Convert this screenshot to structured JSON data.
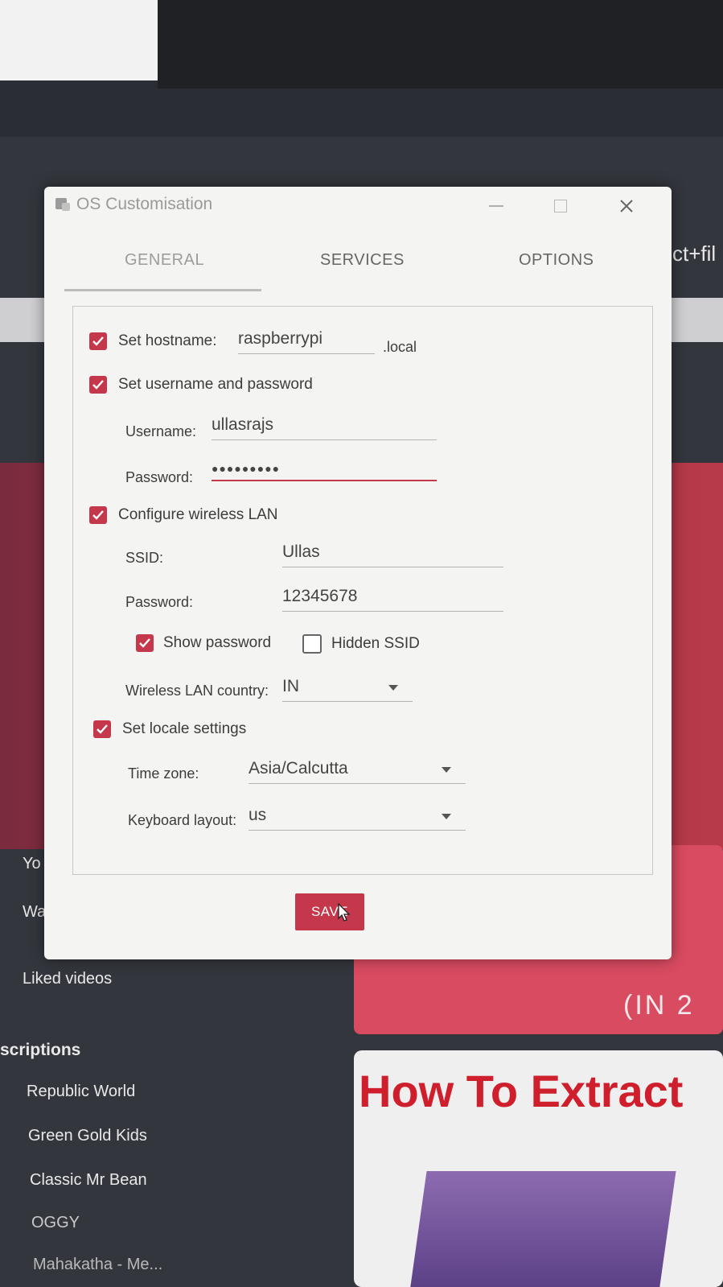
{
  "dialog": {
    "title": "OS Customisation",
    "tabs": [
      "GENERAL",
      "SERVICES",
      "OPTIONS"
    ],
    "active_tab": "GENERAL",
    "hostname": {
      "label": "Set hostname:",
      "checked": true,
      "value": "raspberrypi",
      "suffix": ".local"
    },
    "user": {
      "label": "Set username and password",
      "checked": true,
      "username_label": "Username:",
      "username": "ullasrajs",
      "password_label": "Password:",
      "password_mask": "●●●●●●●●●"
    },
    "wifi": {
      "label": "Configure wireless LAN",
      "checked": true,
      "ssid_label": "SSID:",
      "ssid": "Ullas",
      "password_label": "Password:",
      "password": "12345678",
      "show_password_label": "Show password",
      "show_password": true,
      "hidden_ssid_label": "Hidden SSID",
      "hidden_ssid": false,
      "country_label": "Wireless LAN country:",
      "country": "IN"
    },
    "locale": {
      "label": "Set locale settings",
      "checked": true,
      "timezone_label": "Time zone:",
      "timezone": "Asia/Calcutta",
      "keyboard_label": "Keyboard layout:",
      "keyboard": "us"
    },
    "save_label": "SAVE",
    "accent_color": "#c5374a"
  },
  "background": {
    "right_label": "ct+fil",
    "thumb_text": "(IN 2",
    "thumb_title": "How To Extract",
    "sidebar": {
      "items_top": [
        "Yo",
        "Wa"
      ],
      "liked": "Liked videos",
      "section": "scriptions",
      "subscriptions": [
        "Republic World",
        "Green Gold Kids",
        "Classic Mr Bean",
        "OGGY",
        "Mahakatha - Me..."
      ]
    }
  }
}
